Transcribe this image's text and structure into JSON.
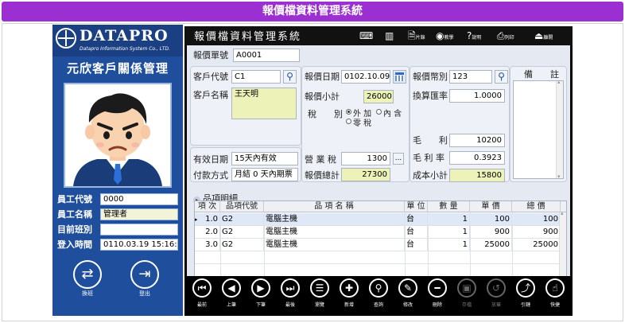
{
  "banner": {
    "title": "報價檔資料管理系統"
  },
  "brand": {
    "name": "DATAPRO",
    "sub": "Datapro Information System Co., LTD."
  },
  "sidebar": {
    "app_title": "元欣客戶關係管理",
    "employee": {
      "id_label": "員工代號",
      "id_value": "0000",
      "name_label": "員工名稱",
      "name_value": "管理者",
      "shift_label": "目前班別",
      "shift_value": "",
      "login_label": "登入時間",
      "login_value": "0110.03.19 15:16:30"
    },
    "buttons": {
      "switch": "換班",
      "logout": "登出"
    }
  },
  "window": {
    "title": "報價檔資料管理系統",
    "toolbar_icons": {
      "chart": "片錄",
      "teach": "教學",
      "help": "說明",
      "print": "列印",
      "leave": "離開"
    }
  },
  "form": {
    "quote_no_label": "報價單號",
    "quote_no": "A0001",
    "customer_code_label": "客戶代號",
    "customer_code": "C1",
    "customer_name_label": "客戶名稱",
    "customer_name": "王天明",
    "quote_date_label": "報價日期",
    "quote_date": "0102.10.09",
    "currency_label": "報價幣別",
    "currency": "123",
    "exchange_label": "換算匯率",
    "exchange": "1.0000",
    "notes_label": "備　　註",
    "subtotal_label": "報價小計",
    "subtotal": "26000",
    "tax_type_label": "稅　　別",
    "tax_options": [
      "外 加",
      "內 含",
      "零 稅"
    ],
    "tax_selected": 0,
    "gross_label": "毛　　利",
    "gross": "10200",
    "gross_rate_label": "毛 利 率",
    "gross_rate": "0.3923",
    "valid_label": "有效日期",
    "valid": "15天內有效",
    "payment_label": "付款方式",
    "payment": "月結 0 天內期票",
    "biz_tax_label": "營 業 稅",
    "biz_tax": "1300",
    "total_label": "報價總計",
    "total": "27300",
    "cost_label": "成本小計",
    "cost": "15800"
  },
  "detail": {
    "title": "品項明細",
    "columns": [
      "項 次",
      "品項代號",
      "品 項 名 稱",
      "單 位",
      "數 量",
      "單 價",
      "總 價"
    ],
    "rows": [
      {
        "seq": "1.0",
        "code": "G2",
        "name": "電腦主機",
        "unit": "台",
        "qty": "1",
        "price": "100",
        "total": "100"
      },
      {
        "seq": "2.0",
        "code": "G2",
        "name": "電腦主機",
        "unit": "台",
        "qty": "1",
        "price": "900",
        "total": "900"
      },
      {
        "seq": "3.0",
        "code": "G2",
        "name": "電腦主機",
        "unit": "台",
        "qty": "1",
        "price": "25000",
        "total": "25000"
      }
    ]
  },
  "toolbar": {
    "first": "最前",
    "prev": "上筆",
    "next": "下筆",
    "last": "最後",
    "browse": "瀏覽",
    "add": "新增",
    "query": "查詢",
    "edit": "修改",
    "delete": "刪除",
    "save": "存檔",
    "cancel": "放棄",
    "copy": "引鏈",
    "quick": "快捷"
  },
  "colors": {
    "banner": "#9b2fd1",
    "sidebar": "#1f4f9c",
    "highlight": "#ecf2b8",
    "window": "#000000"
  }
}
